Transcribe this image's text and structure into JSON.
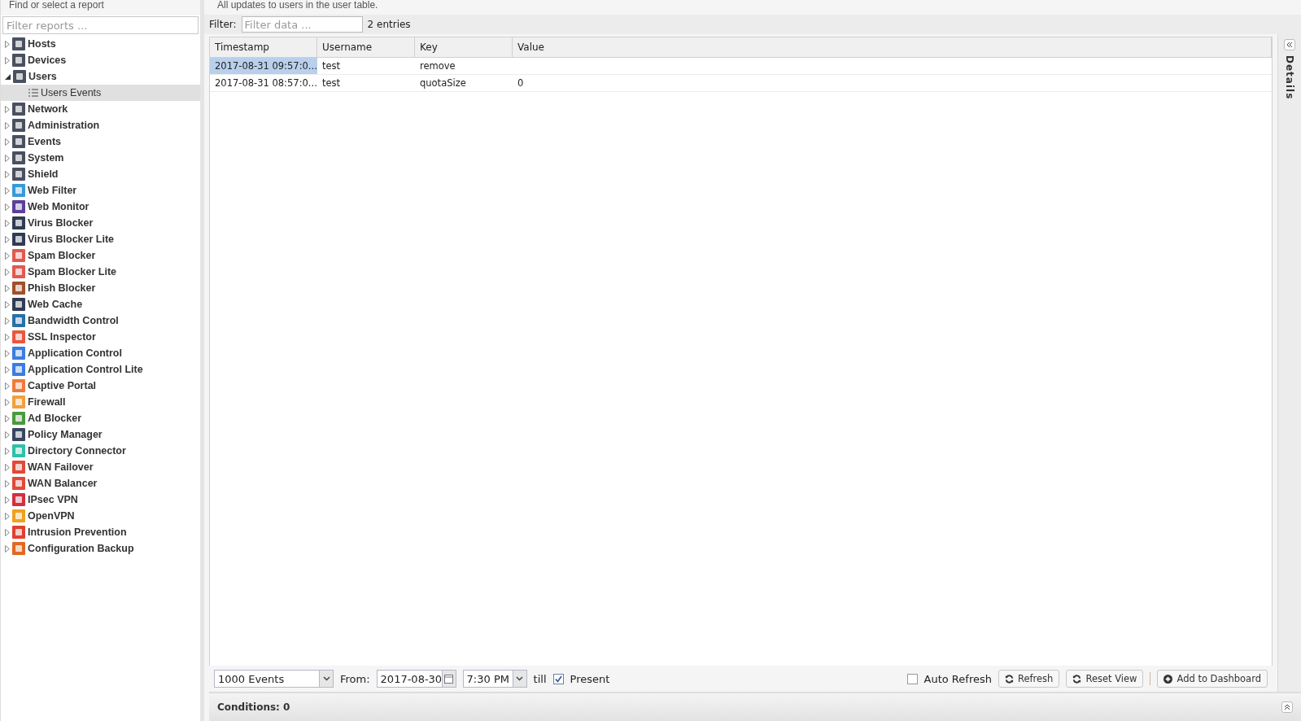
{
  "sidebar": {
    "title": "Find or select a report",
    "filter": {
      "placeholder": "Filter reports ..."
    },
    "items": [
      {
        "label": "Hosts",
        "color": "#4a5060",
        "expanded": false,
        "selected": false
      },
      {
        "label": "Devices",
        "color": "#4a5060",
        "expanded": false,
        "selected": false
      },
      {
        "label": "Users",
        "color": "#4a5060",
        "expanded": true,
        "selected": false,
        "children": [
          {
            "label": "Users Events",
            "selected": true
          }
        ]
      },
      {
        "label": "Network",
        "color": "#4a5060",
        "expanded": false,
        "selected": false
      },
      {
        "label": "Administration",
        "color": "#4a5060",
        "expanded": false,
        "selected": false
      },
      {
        "label": "Events",
        "color": "#4a5060",
        "expanded": false,
        "selected": false
      },
      {
        "label": "System",
        "color": "#4a5060",
        "expanded": false,
        "selected": false
      },
      {
        "label": "Shield",
        "color": "#4a5060",
        "expanded": false,
        "selected": false
      },
      {
        "label": "Web Filter",
        "color": "#3a9ad9",
        "expanded": false,
        "selected": false
      },
      {
        "label": "Web Monitor",
        "color": "#5b3f9a",
        "expanded": false,
        "selected": false
      },
      {
        "label": "Virus Blocker",
        "color": "#2f3c52",
        "expanded": false,
        "selected": false
      },
      {
        "label": "Virus Blocker Lite",
        "color": "#2f3c52",
        "expanded": false,
        "selected": false
      },
      {
        "label": "Spam Blocker",
        "color": "#e05a50",
        "expanded": false,
        "selected": false
      },
      {
        "label": "Spam Blocker Lite",
        "color": "#e05a50",
        "expanded": false,
        "selected": false
      },
      {
        "label": "Phish Blocker",
        "color": "#a0502a",
        "expanded": false,
        "selected": false
      },
      {
        "label": "Web Cache",
        "color": "#2f3c52",
        "expanded": false,
        "selected": false
      },
      {
        "label": "Bandwidth Control",
        "color": "#2a6fa8",
        "expanded": false,
        "selected": false
      },
      {
        "label": "SSL Inspector",
        "color": "#e8583f",
        "expanded": false,
        "selected": false
      },
      {
        "label": "Application Control",
        "color": "#3b7de0",
        "expanded": false,
        "selected": false
      },
      {
        "label": "Application Control Lite",
        "color": "#3b7de0",
        "expanded": false,
        "selected": false
      },
      {
        "label": "Captive Portal",
        "color": "#f07a3a",
        "expanded": false,
        "selected": false
      },
      {
        "label": "Firewall",
        "color": "#f0a040",
        "expanded": false,
        "selected": false
      },
      {
        "label": "Ad Blocker",
        "color": "#4a9a40",
        "expanded": false,
        "selected": false
      },
      {
        "label": "Policy Manager",
        "color": "#3a4560",
        "expanded": false,
        "selected": false
      },
      {
        "label": "Directory Connector",
        "color": "#30c0a8",
        "expanded": false,
        "selected": false
      },
      {
        "label": "WAN Failover",
        "color": "#e04a3a",
        "expanded": false,
        "selected": false
      },
      {
        "label": "WAN Balancer",
        "color": "#e04a3a",
        "expanded": false,
        "selected": false
      },
      {
        "label": "IPsec VPN",
        "color": "#d03040",
        "expanded": false,
        "selected": false
      },
      {
        "label": "OpenVPN",
        "color": "#f0a020",
        "expanded": false,
        "selected": false
      },
      {
        "label": "Intrusion Prevention",
        "color": "#e04030",
        "expanded": false,
        "selected": false
      },
      {
        "label": "Configuration Backup",
        "color": "#e06a20",
        "expanded": false,
        "selected": false
      }
    ]
  },
  "report": {
    "description": "All updates to users in the user table.",
    "filter": {
      "label": "Filter:",
      "placeholder": "Filter data ...",
      "count": "2 entries"
    },
    "table": {
      "columns": [
        "Timestamp",
        "Username",
        "Key",
        "Value"
      ],
      "rows": [
        {
          "cells": [
            "2017-08-31 09:57:0...",
            "test",
            "remove",
            ""
          ],
          "selected": true
        },
        {
          "cells": [
            "2017-08-31 08:57:0...",
            "test",
            "quotaSize",
            "0"
          ],
          "selected": false
        }
      ]
    },
    "toolbar": {
      "limit": "1000 Events",
      "from_label": "From:",
      "date": "2017-08-30",
      "time": "7:30 PM",
      "till_label": "till",
      "present": {
        "label": "Present",
        "checked": true
      },
      "auto_refresh": {
        "label": "Auto Refresh",
        "checked": false
      },
      "buttons": [
        {
          "label": "Refresh",
          "kind": "refresh"
        },
        {
          "label": "Reset View",
          "kind": "refresh"
        },
        {
          "label": "Add to Dashboard",
          "kind": "add"
        }
      ]
    },
    "conditions": "Conditions: 0"
  },
  "details": {
    "title": "Details"
  }
}
